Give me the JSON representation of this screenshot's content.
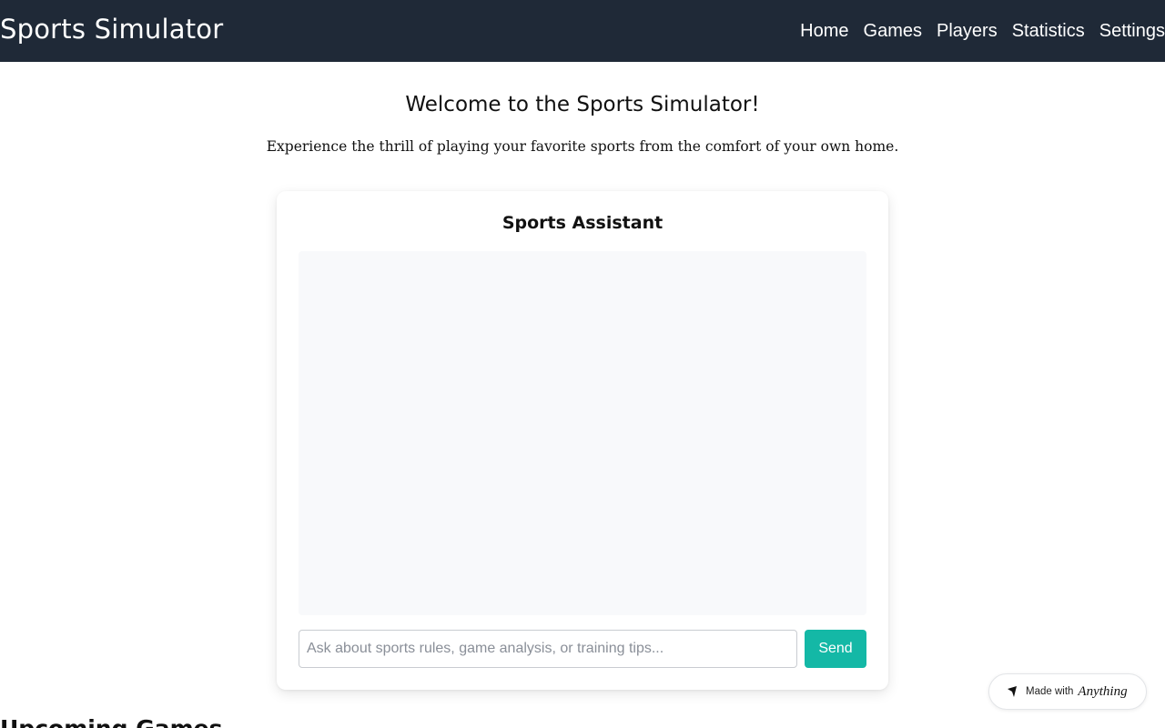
{
  "header": {
    "brand": "Sports Simulator",
    "nav": [
      "Home",
      "Games",
      "Players",
      "Statistics",
      "Settings"
    ]
  },
  "hero": {
    "title": "Welcome to the Sports Simulator!",
    "subtitle": "Experience the thrill of playing your favorite sports from the comfort of your own home."
  },
  "assistant": {
    "title": "Sports Assistant",
    "input_placeholder": "Ask about sports rules, game analysis, or training tips...",
    "input_value": "",
    "send_label": "Send"
  },
  "section": {
    "heading": "Upcoming Games"
  },
  "badge": {
    "text": "Made with",
    "brand": "Anything",
    "icon": "anything-logo-icon"
  },
  "colors": {
    "header_bg": "#1f2937",
    "accent": "#14b8a6",
    "chat_bg": "#f8f9fb"
  }
}
